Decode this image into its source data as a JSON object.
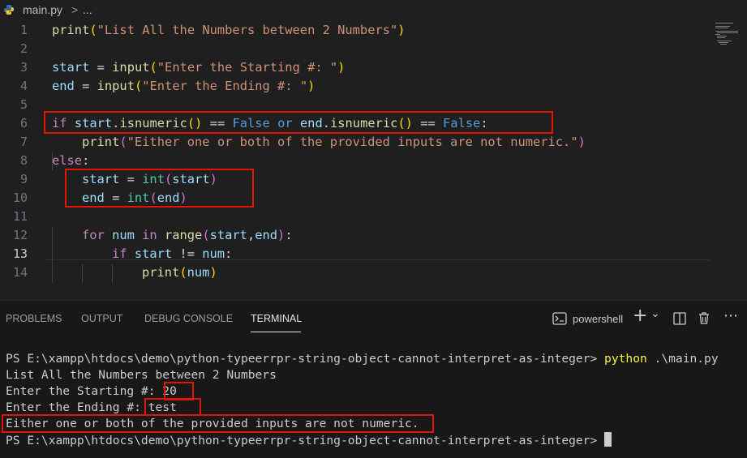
{
  "breadcrumb": {
    "file": "main.py",
    "separator": ">",
    "ellipsis": "..."
  },
  "code": {
    "line_numbers": [
      "1",
      "2",
      "3",
      "4",
      "5",
      "6",
      "7",
      "8",
      "9",
      "10",
      "11",
      "12",
      "13",
      "14"
    ],
    "l1": {
      "fn": "print",
      "p1": "(",
      "str": "\"List All the Numbers between 2 Numbers\"",
      "p2": ")"
    },
    "l3": {
      "var": "start",
      "eq": " = ",
      "fn": "input",
      "p1": "(",
      "str": "\"Enter the Starting #: \"",
      "p2": ")"
    },
    "l4": {
      "var": "end",
      "eq": " = ",
      "fn": "input",
      "p1": "(",
      "str": "\"Enter the Ending #: \"",
      "p2": ")"
    },
    "l6": {
      "if": "if",
      "v1": "start",
      "d1": ".",
      "f1": "isnumeric",
      "pp1": "()",
      "eq1": " == ",
      "k1": "False",
      "or": " or ",
      "v2": "end",
      "d2": ".",
      "f2": "isnumeric",
      "pp2": "()",
      "eq2": " == ",
      "k2": "False",
      "colon": ":"
    },
    "l7": {
      "fn": "print",
      "p1": "(",
      "str": "\"Either one or both of the provided inputs are not numeric.\"",
      "p2": ")"
    },
    "l8": {
      "else": "else",
      "colon": ":"
    },
    "l9": {
      "var": "start",
      "eq": " = ",
      "cls": "int",
      "p1": "(",
      "arg": "start",
      "p2": ")"
    },
    "l10": {
      "var": "end",
      "eq": " = ",
      "cls": "int",
      "p1": "(",
      "arg": "end",
      "p2": ")"
    },
    "l12": {
      "for": "for",
      "var": " num ",
      "in": "in",
      "fn": " range",
      "p1": "(",
      "a1": "start",
      "comma": ",",
      "a2": "end",
      "p2": ")",
      "colon": ":"
    },
    "l13": {
      "if": "if",
      "v1": " start",
      "op": " != ",
      "v2": "num",
      "colon": ":"
    },
    "l14": {
      "fn": "print",
      "p1": "(",
      "arg": "num",
      "p2": ")"
    }
  },
  "panel": {
    "tabs": [
      "PROBLEMS",
      "OUTPUT",
      "DEBUG CONSOLE",
      "TERMINAL"
    ],
    "active_tab": "TERMINAL",
    "shell": "powershell",
    "plus": "+",
    "chevron": "⌄"
  },
  "terminal": {
    "prompt": "PS E:\\xampp\\htdocs\\demo\\python-typeerrpr-string-object-cannot-interpret-as-integer> ",
    "command": "python",
    "command_arg": " .\\main.py",
    "out1": "List All the Numbers between 2 Numbers",
    "out2_label": "Enter the Starting #: ",
    "out2_value": "20",
    "out3_label": "Enter the Ending #: ",
    "out3_value": "test",
    "out4": "Either one or both of the provided inputs are not numeric.",
    "prompt2": "PS E:\\xampp\\htdocs\\demo\\python-typeerrpr-string-object-cannot-interpret-as-integer> "
  },
  "colors": {
    "highlight_box": "#e51400",
    "background": "#1f1f1f",
    "terminal_command": "#f5f543"
  }
}
